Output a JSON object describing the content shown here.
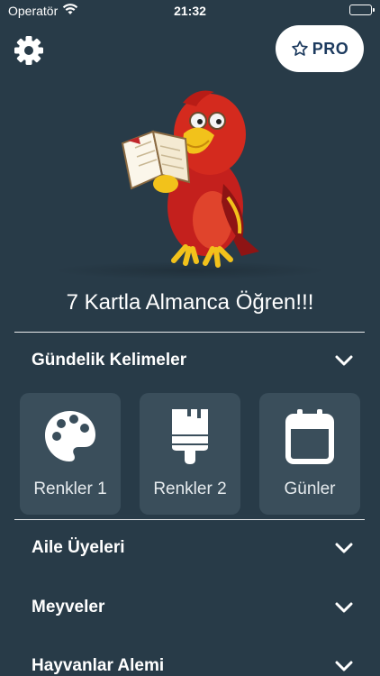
{
  "status_bar": {
    "carrier": "Operatör",
    "time": "21:32"
  },
  "header": {
    "settings_icon": "gear-icon",
    "pro_label": "PRO",
    "pro_icon": "star-outline-icon"
  },
  "title": "7 Kartla Almanca Öğren!!!",
  "sections": [
    {
      "label": "Gündelik Kelimeler",
      "expanded": true,
      "cards": [
        {
          "label": "Renkler 1",
          "icon": "palette-icon"
        },
        {
          "label": "Renkler 2",
          "icon": "paint-brush-icon"
        },
        {
          "label": "Günler",
          "icon": "calendar-icon"
        }
      ]
    },
    {
      "label": "Aile Üyeleri",
      "expanded": false
    },
    {
      "label": "Meyveler",
      "expanded": false
    },
    {
      "label": "Hayvanlar Alemi",
      "expanded": false
    }
  ],
  "colors": {
    "background": "#283b48",
    "card": "#3a4e5b",
    "pro_text": "#1c3a5e"
  }
}
